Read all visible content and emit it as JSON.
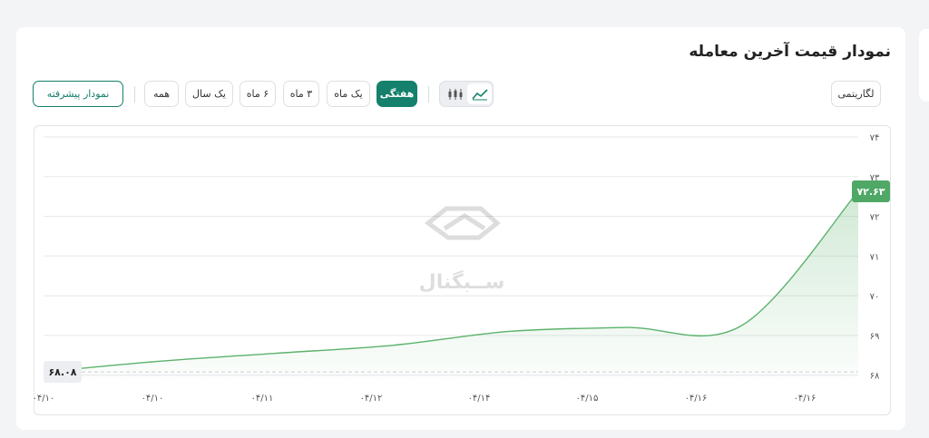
{
  "header": {
    "title": "نمودار قیمت آخرین معامله"
  },
  "toolbar": {
    "log_label": "لگاریتمی",
    "periods": [
      "هفتگی",
      "یک ماه",
      "۳ ماه",
      "۶ ماه",
      "یک سال",
      "همه"
    ],
    "active_period": "هفتگی",
    "advanced_label": "نمودار پیشرفته",
    "chart_type_icons": [
      "line-chart-icon",
      "candlestick-icon"
    ]
  },
  "watermark": {
    "text": "ســبگنال"
  },
  "colors": {
    "accent": "#15806b",
    "line": "#5cb26c",
    "price_tag": "#4fa865",
    "grid": "#e6e8eb"
  },
  "chart_data": {
    "type": "area",
    "x": [
      "۰۴/۱۰",
      "۰۴/۱۰",
      "۰۴/۱۱",
      "۰۴/۱۲",
      "۰۴/۱۴",
      "۰۴/۱۵",
      "۰۴/۱۶",
      "۰۴/۱۶"
    ],
    "series": [
      {
        "values": [
          68.08,
          68.35,
          68.55,
          68.75,
          69.1,
          69.2,
          69.25,
          72.63
        ]
      }
    ],
    "ylim": [
      67.9,
      74
    ],
    "yticks": [
      74,
      73,
      72,
      71,
      70,
      69,
      68
    ],
    "ytick_labels": [
      "۷۴",
      "۷۳",
      "۷۲",
      "۷۱",
      "۷۰",
      "۶۹",
      "۶۸"
    ],
    "last_price_label": "۷۲.۶۳",
    "first_price_label": "۶۸.۰۸",
    "grid": true
  }
}
